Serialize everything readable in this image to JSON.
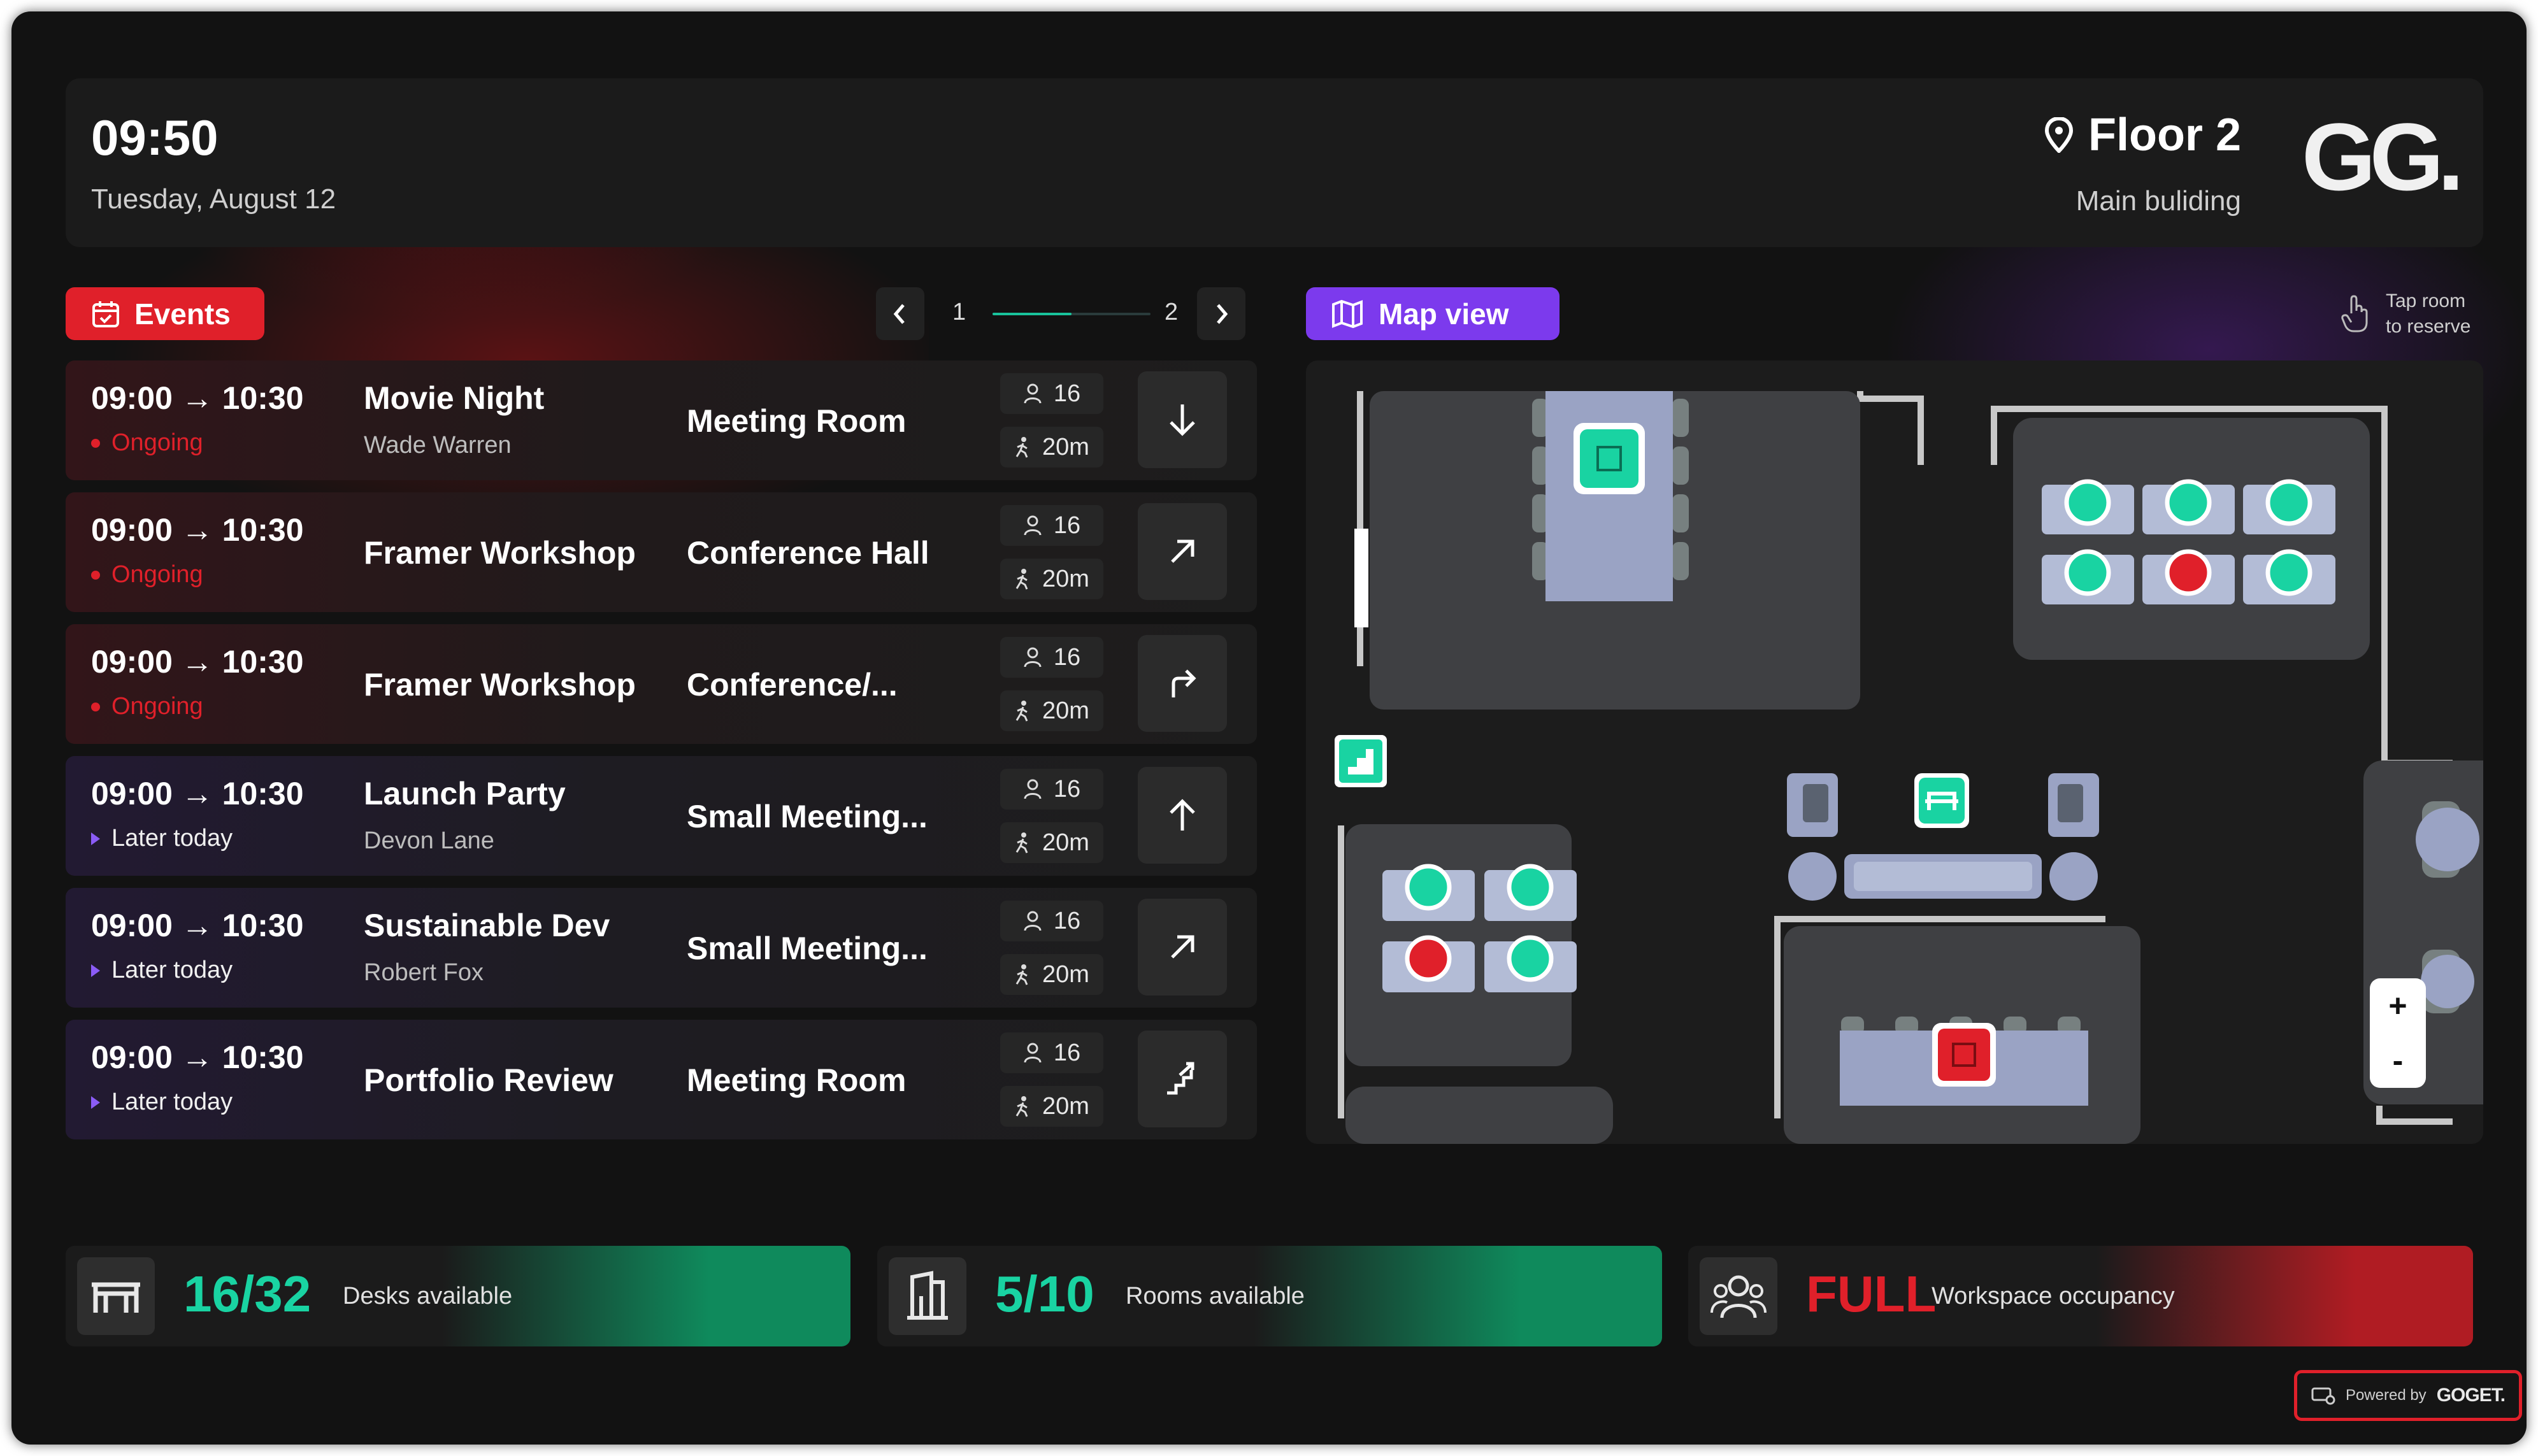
{
  "header": {
    "time": "09:50",
    "date": "Tuesday, August 12",
    "floor": "Floor 2",
    "building": "Main buliding",
    "logo": "GG."
  },
  "events_panel": {
    "badge_label": "Events",
    "pager": {
      "current": "1",
      "total": "2",
      "progress": 0.5
    },
    "items": [
      {
        "time": "09:00 → 10:30",
        "title": "Movie Night",
        "host": "Wade Warren",
        "status": "Ongoing",
        "status_type": "ongoing",
        "room": "Meeting Room",
        "capacity": "16",
        "walk": "20m",
        "direction_icon": "arrow-down-icon"
      },
      {
        "time": "09:00 → 10:30",
        "title": "Framer Workshop",
        "host": "",
        "status": "Ongoing",
        "status_type": "ongoing",
        "room": "Conference Hall",
        "capacity": "16",
        "walk": "20m",
        "direction_icon": "arrow-up-right-icon"
      },
      {
        "time": "09:00 → 10:30",
        "title": "Framer Workshop",
        "host": "",
        "status": "Ongoing",
        "status_type": "ongoing",
        "room": "Conference/...",
        "capacity": "16",
        "walk": "20m",
        "direction_icon": "turn-right-icon"
      },
      {
        "time": "09:00 → 10:30",
        "title": "Launch Party",
        "host": "Devon Lane",
        "status": "Later today",
        "status_type": "later",
        "room": "Small Meeting...",
        "capacity": "16",
        "walk": "20m",
        "direction_icon": "arrow-up-icon"
      },
      {
        "time": "09:00 → 10:30",
        "title": "Sustainable Dev",
        "host": "Robert Fox",
        "status": "Later today",
        "status_type": "later",
        "room": "Small Meeting...",
        "capacity": "16",
        "walk": "20m",
        "direction_icon": "arrow-up-right-icon"
      },
      {
        "time": "09:00 → 10:30",
        "title": "Portfolio Review",
        "host": "",
        "status": "Later today",
        "status_type": "later",
        "room": "Meeting Room",
        "capacity": "16",
        "walk": "20m",
        "direction_icon": "stairs-up-icon"
      }
    ]
  },
  "map_panel": {
    "badge_label": "Map view",
    "hint_line1": "Tap room",
    "hint_line2": "to reserve",
    "zoom_in": "+",
    "zoom_out": "-"
  },
  "stats": [
    {
      "value": "16/32",
      "label": "Desks available",
      "value_color": "#19d3a2",
      "icon": "desk-icon"
    },
    {
      "value": "5/10",
      "label": "Rooms available",
      "value_color": "#19d3a2",
      "icon": "building-icon"
    },
    {
      "value": "FULL",
      "label": "Workspace occupancy",
      "value_color": "#e0202a",
      "icon": "people-icon"
    }
  ],
  "footer": {
    "powered_by": "Powered by",
    "brand": "GOGET."
  },
  "colors": {
    "accent_red": "#e0202a",
    "accent_purple": "#7c3aed",
    "available_green": "#19d3a2",
    "occupied_red": "#e0202a"
  }
}
